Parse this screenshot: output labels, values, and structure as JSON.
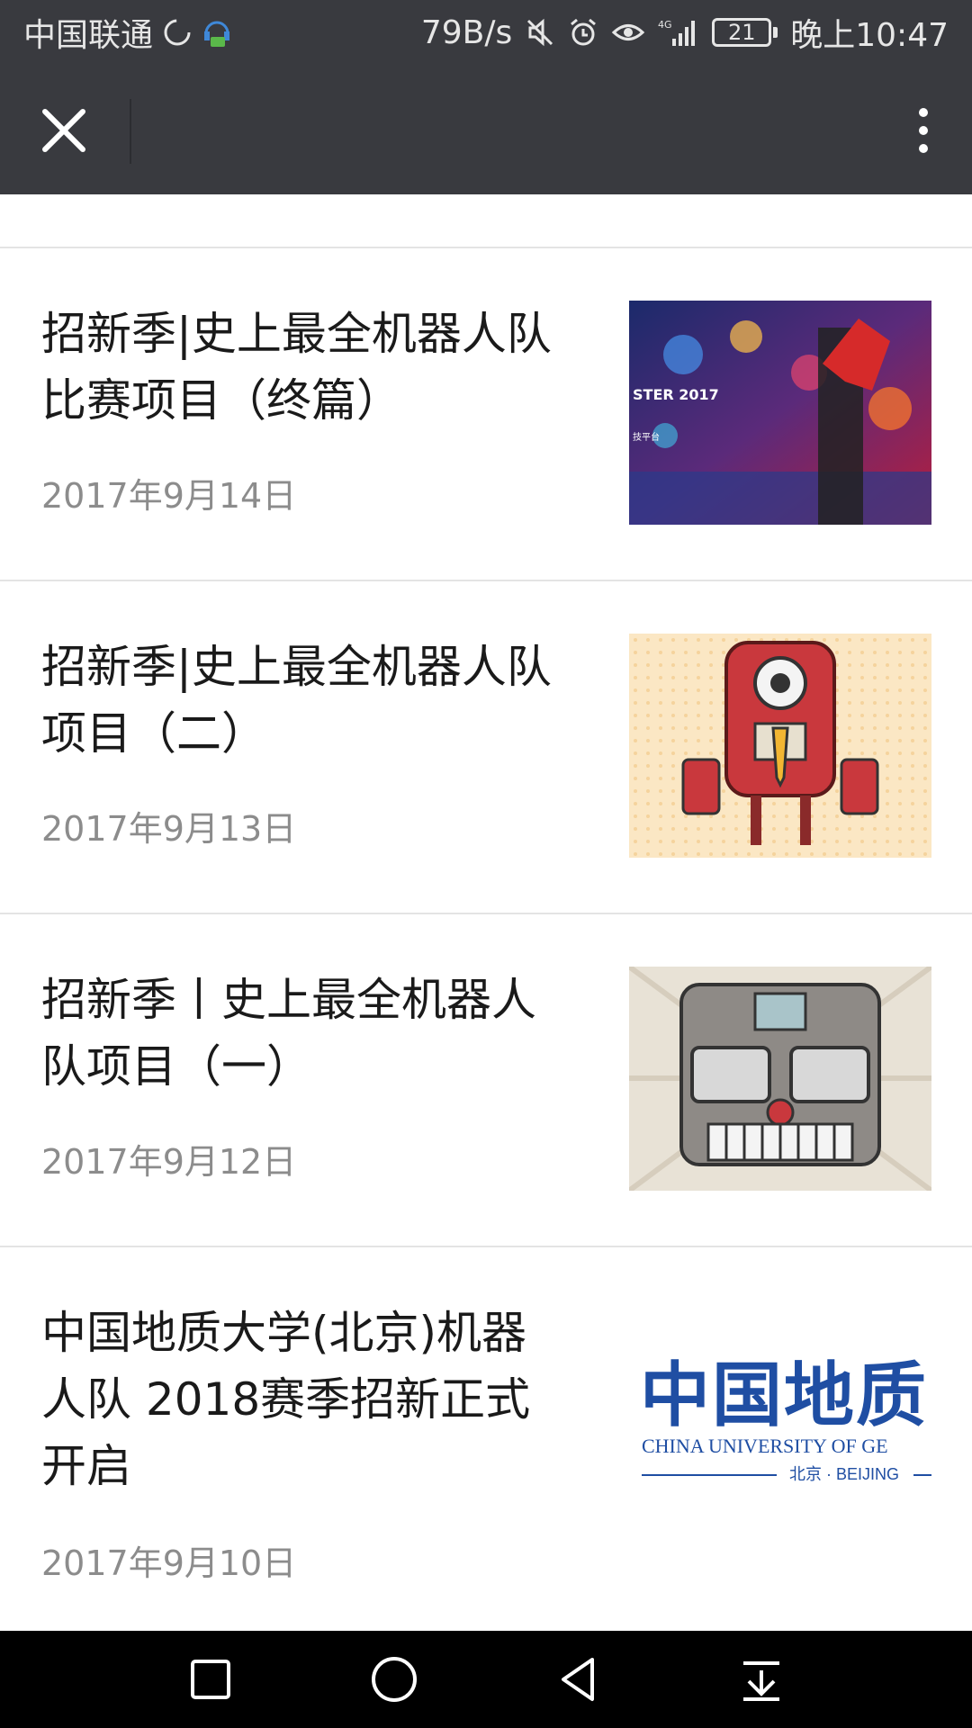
{
  "status_bar": {
    "carrier": "中国联通",
    "net_speed": "79B/s",
    "network": "4G",
    "battery": "21",
    "time": "晚上10:47"
  },
  "articles": [
    {
      "title_line1": "招新季|史上最全机器人队",
      "title_line2": "比赛项目（终篇）",
      "date": "2017年9月14日",
      "thumb_text_1": "STER 2017",
      "thumb_text_2": "技平台"
    },
    {
      "title_line1": "招新季|史上最全机器人队",
      "title_line2": "项目（二）",
      "date": "2017年9月13日"
    },
    {
      "title_line1": "招新季丨史上最全机器人",
      "title_line2": "队项目（一）",
      "date": "2017年9月12日"
    },
    {
      "title_line1": "中国地质大学(北京)机器",
      "title_line2": "人队 2018赛季招新正式",
      "title_line3": "开启",
      "date": "2017年9月10日",
      "thumb_logo_cn": "中国地质",
      "thumb_logo_en": "CHINA UNIVERSITY OF GE",
      "thumb_logo_city": "北京 · BEIJING"
    }
  ],
  "colors": {
    "bar_bg": "#393a3f",
    "date_text": "#8c8c8c",
    "logo_blue": "#1f4ea3"
  }
}
